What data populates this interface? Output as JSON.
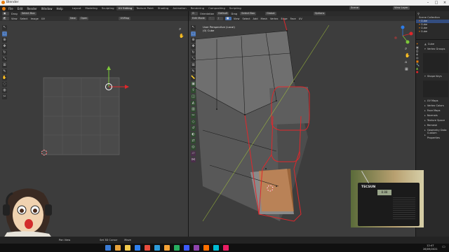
{
  "window": {
    "title": "Blender"
  },
  "menubar": {
    "menus": [
      "File",
      "Edit",
      "Render",
      "Window",
      "Help"
    ],
    "workspaces": [
      {
        "label": "Layout",
        "active": false
      },
      {
        "label": "Modeling",
        "active": false
      },
      {
        "label": "Sculpting",
        "active": false
      },
      {
        "label": "UV Editing",
        "active": true
      },
      {
        "label": "Texture Paint",
        "active": false
      },
      {
        "label": "Shading",
        "active": false
      },
      {
        "label": "Animation",
        "active": false
      },
      {
        "label": "Rendering",
        "active": false
      },
      {
        "label": "Compositing",
        "active": false
      },
      {
        "label": "Scripting",
        "active": false
      }
    ],
    "scene_label": "Scene",
    "view_layer_label": "View Layer"
  },
  "uv_editor": {
    "header": {
      "mode": "Drag",
      "select": "Select Box"
    },
    "header2": {
      "items": [
        "View",
        "Select",
        "Image",
        "UV"
      ],
      "new_label": "New",
      "open_label": "Open",
      "uvmap_label": "UVMap"
    }
  },
  "viewport": {
    "header": {
      "orientation": "Orientation",
      "orientation_value": "Default",
      "drag": "Drag",
      "select": "Select Box",
      "transform": "Global"
    },
    "header2": {
      "mode": "Edit Mode",
      "items": [
        "View",
        "Select",
        "Add",
        "Mesh",
        "Vertex",
        "Edge",
        "Face",
        "UV"
      ]
    },
    "overlay_line1": "User Perspective (Local)",
    "overlay_line2": "(0) Cube",
    "options_label": "Options"
  },
  "outliner": {
    "title": "Scene Collection",
    "rows": [
      {
        "label": "Scene Collection",
        "selected": false
      },
      {
        "label": "Cube",
        "selected": true
      },
      {
        "label": "Cube",
        "selected": false
      },
      {
        "label": "Cube",
        "selected": false
      },
      {
        "label": "Cube",
        "selected": false
      }
    ]
  },
  "properties": {
    "object_name": "Cube",
    "vertex_groups": "Vertex Groups",
    "shape_keys": "Shape Keys",
    "sections": [
      "UV Maps",
      "Vertex Colors",
      "Face Maps",
      "Normals",
      "Texture Space",
      "Remesh",
      "Geometry Data",
      "Custom Properties"
    ]
  },
  "webcam": {
    "brand": "TECSUN",
    "display": "8.88"
  },
  "statusbar": {
    "left": "Pan View",
    "mid1": "Set 3D Cursor",
    "mid2": "Move"
  },
  "taskbar": {
    "time": "12:47",
    "date": "26/09/2021",
    "icon_colors": [
      "#3a7bd5",
      "#e8a23a",
      "#f2c94c",
      "#2f80ed",
      "#e84c3d",
      "#2d9cdb",
      "#f4a236",
      "#27ae60",
      "#3d5afe",
      "#8e44ad",
      "#ff6f00",
      "#00bcd4",
      "#e91e63"
    ]
  },
  "colors": {
    "accent": "#4772b3",
    "edge_select": "#e0272b",
    "face_select": "#e07b2e",
    "x_axis": "#e0272b",
    "y_axis": "#7dc83a"
  }
}
